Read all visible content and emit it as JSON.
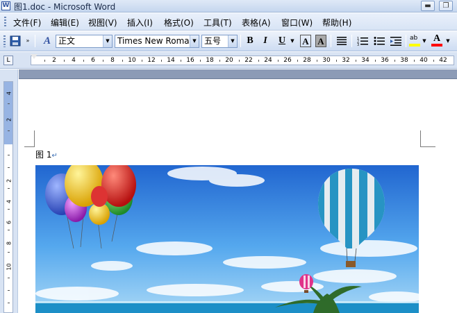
{
  "window": {
    "title": "图1.doc - Microsoft Word",
    "app_icon": "word-doc-icon"
  },
  "menu": {
    "items": [
      "文件(F)",
      "编辑(E)",
      "视图(V)",
      "插入(I)",
      "格式(O)",
      "工具(T)",
      "表格(A)",
      "窗口(W)",
      "帮助(H)"
    ]
  },
  "toolbar": {
    "style_value": "正文",
    "font_value": "Times New Roman",
    "size_value": "五号",
    "bold_label": "B",
    "italic_label": "I",
    "underline_label": "U",
    "border_a_label": "A",
    "shade_a_label": "A",
    "font_color_label": "A",
    "highlight_label": "ab",
    "style_icon_label": "A"
  },
  "ruler": {
    "corner_label": "L",
    "ticks": [
      "2",
      "4",
      "6",
      "8",
      "10",
      "12",
      "14",
      "16",
      "18",
      "20",
      "22",
      "24",
      "26",
      "28",
      "30",
      "32",
      "34",
      "36",
      "38",
      "40",
      "42"
    ],
    "vticks": [
      "4",
      "2",
      "2",
      "4",
      "6",
      "8",
      "10"
    ]
  },
  "document": {
    "caption": "图 1",
    "paragraph_mark": "↵"
  },
  "colors": {
    "sky_top": "#2a76d6",
    "sea": "#1c8fc7",
    "balloon_blue": "#3aa8d8"
  }
}
